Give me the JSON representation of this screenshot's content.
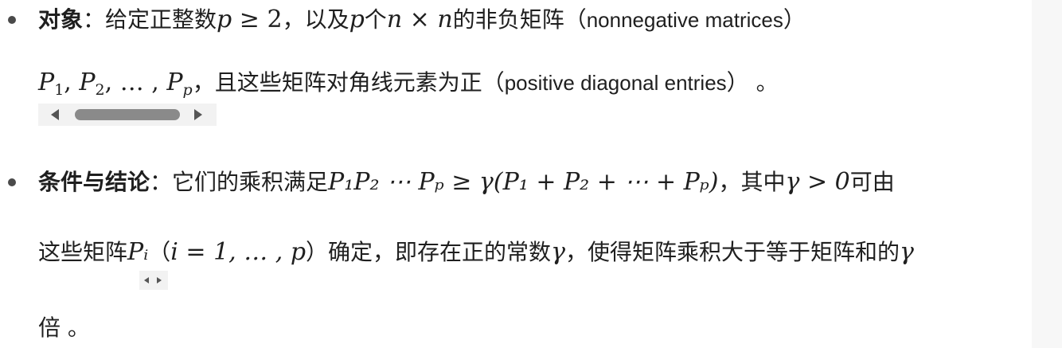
{
  "item1": {
    "label": "对象",
    "colon": "：",
    "t1": "给定正整数",
    "m_p": "p",
    "m_ge2": " ≥ 2",
    "t2": "，以及",
    "m_p2": "p",
    "t3": "个",
    "m_n1": "n",
    "m_times": " × ",
    "m_n2": "n",
    "t4": "的非负矩阵（",
    "eng1": "nonnegative matrices",
    "t5": "）",
    "line2": {
      "P": "P",
      "s1": "1",
      "comma1": ", ",
      "s2": "2",
      "comma2": ", … , ",
      "sp": "p",
      "t6": "，且这些矩阵对角线元素为正（",
      "eng2": "positive diagonal entries",
      "t7": "） 。"
    }
  },
  "item2": {
    "label": "条件与结论",
    "colon": "：",
    "t1": "它们的乘积满足",
    "m_prod": "P₁P₂ ⋯ Pₚ ≥ γ(P₁ + P₂ + ⋯ + Pₚ)",
    "t2": "，其中",
    "m_gamma": "γ > 0",
    "t3": "可由",
    "line2": {
      "t1": "这些矩阵",
      "m_Pi": "Pᵢ",
      "t2": "（",
      "m_range": "i = 1, … , p",
      "t3": "）确定，即存在正的常数",
      "m_gamma": "γ",
      "t4": "，使得矩阵乘积大于等于矩阵和的",
      "m_gamma2": "γ"
    },
    "line3": "倍 。"
  },
  "colors": {
    "text": "#1f1f1f",
    "bullet": "#4a4a4a",
    "scroll_thumb": "#8a8a8a",
    "scroll_track": "#f2f2f2"
  }
}
